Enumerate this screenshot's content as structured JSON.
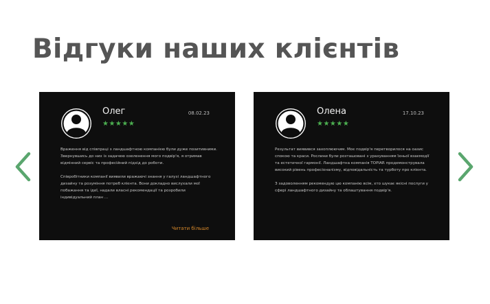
{
  "section": {
    "title": "Відгуки наших клієнтів"
  },
  "colors": {
    "title": "#555555",
    "card_background": "#0e0e0e",
    "arrow": "#5aa66e",
    "stars": "#4caf50",
    "read_more": "#d98a2b"
  },
  "icons": {
    "prev": "chevron-left-icon",
    "next": "chevron-right-icon",
    "avatar": "user-avatar-icon",
    "rating": "star-icon"
  },
  "reviews": [
    {
      "name": "Олег",
      "date": "08.02.23",
      "stars": "★★★★★",
      "rating": 5,
      "paragraphs": [
        "Враження від співпраці з ландшафтною компанією були дуже позитивними. Звернувшись до них із задачею озеленення мого подвір'я, я отримав відмінний сервіс та професійний підхід до роботи.",
        "Співробітники компанії виявили вражаючі знання у галузі ландшафтного дизайну та розуміння потреб клієнта. Вони докладно вислухали мої побажання та ідеї, надали власні рекомендації та розробили індивідуальний план ..."
      ],
      "read_more": "Читати більше"
    },
    {
      "name": "Олена",
      "date": "17.10.23",
      "stars": "★★★★★",
      "rating": 5,
      "paragraphs": [
        "Результат виявився захоплюючим. Моє подвір'я перетворилося на оазис спокою та краси. Рослини були розташовані з урахуванням їхньої взаємодії та естетичної гармонії. Ландшафтна компанія TOPIAR продемонструвала високий рівень професіоналізму, відповідальність та турботу про клієнта.",
        "З задоволенням рекомендую цю компанію всім, хто шукає якісні послуги у сфері ландшафтного дизайну та облаштування подвір'я."
      ]
    }
  ]
}
